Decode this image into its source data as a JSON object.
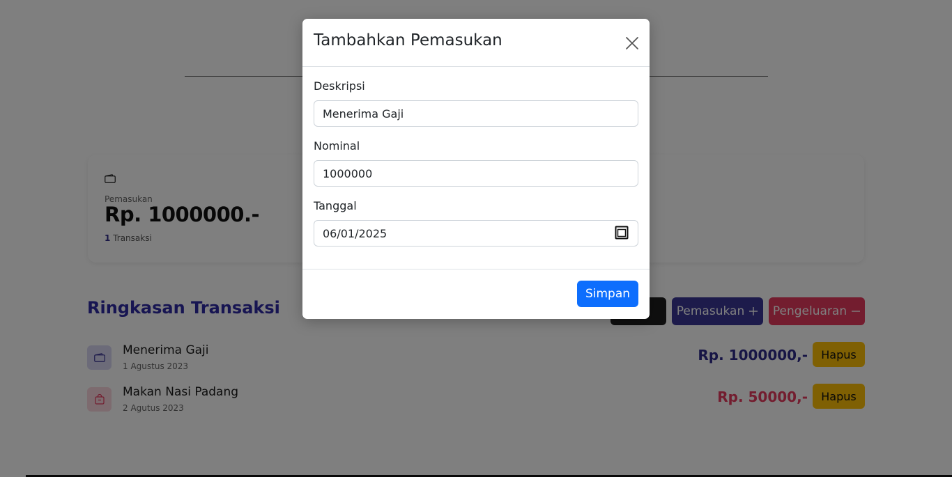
{
  "summary": {
    "label": "Pemasukan",
    "amount": "Rp. 1000000.-",
    "count": "1",
    "count_suffix": "Transaksi"
  },
  "section": {
    "title": "Ringkasan Transaksi"
  },
  "actions": {
    "income_label": "Pemasukan",
    "expense_label": "Pengeluaran"
  },
  "transactions": [
    {
      "title": "Menerima Gaji",
      "date": "1 Agustus 2023",
      "amount": "Rp. 1000000,-",
      "delete_label": "Hapus",
      "type": "income"
    },
    {
      "title": "Makan Nasi Padang",
      "date": "2 Agutus 2023",
      "amount": "Rp. 50000,-",
      "delete_label": "Hapus",
      "type": "expense"
    }
  ],
  "modal": {
    "title": "Tambahkan Pemasukan",
    "description_label": "Deskripsi",
    "description_value": "Menerima Gaji",
    "nominal_label": "Nominal",
    "nominal_value": "1000000",
    "date_label": "Tanggal",
    "date_value": "06/01/2025",
    "save_label": "Simpan"
  },
  "icons": {
    "close": "close-icon",
    "calendar": "calendar-icon",
    "wallet": "wallet-icon",
    "refresh": "refresh-icon",
    "plus": "plus-icon",
    "minus": "minus-icon",
    "bag": "bag-icon"
  },
  "colors": {
    "primary": "#0d6efd",
    "income": "#3b3696",
    "expense": "#e63a5f",
    "warning": "#ffc107",
    "dark": "#1e1e1e"
  }
}
